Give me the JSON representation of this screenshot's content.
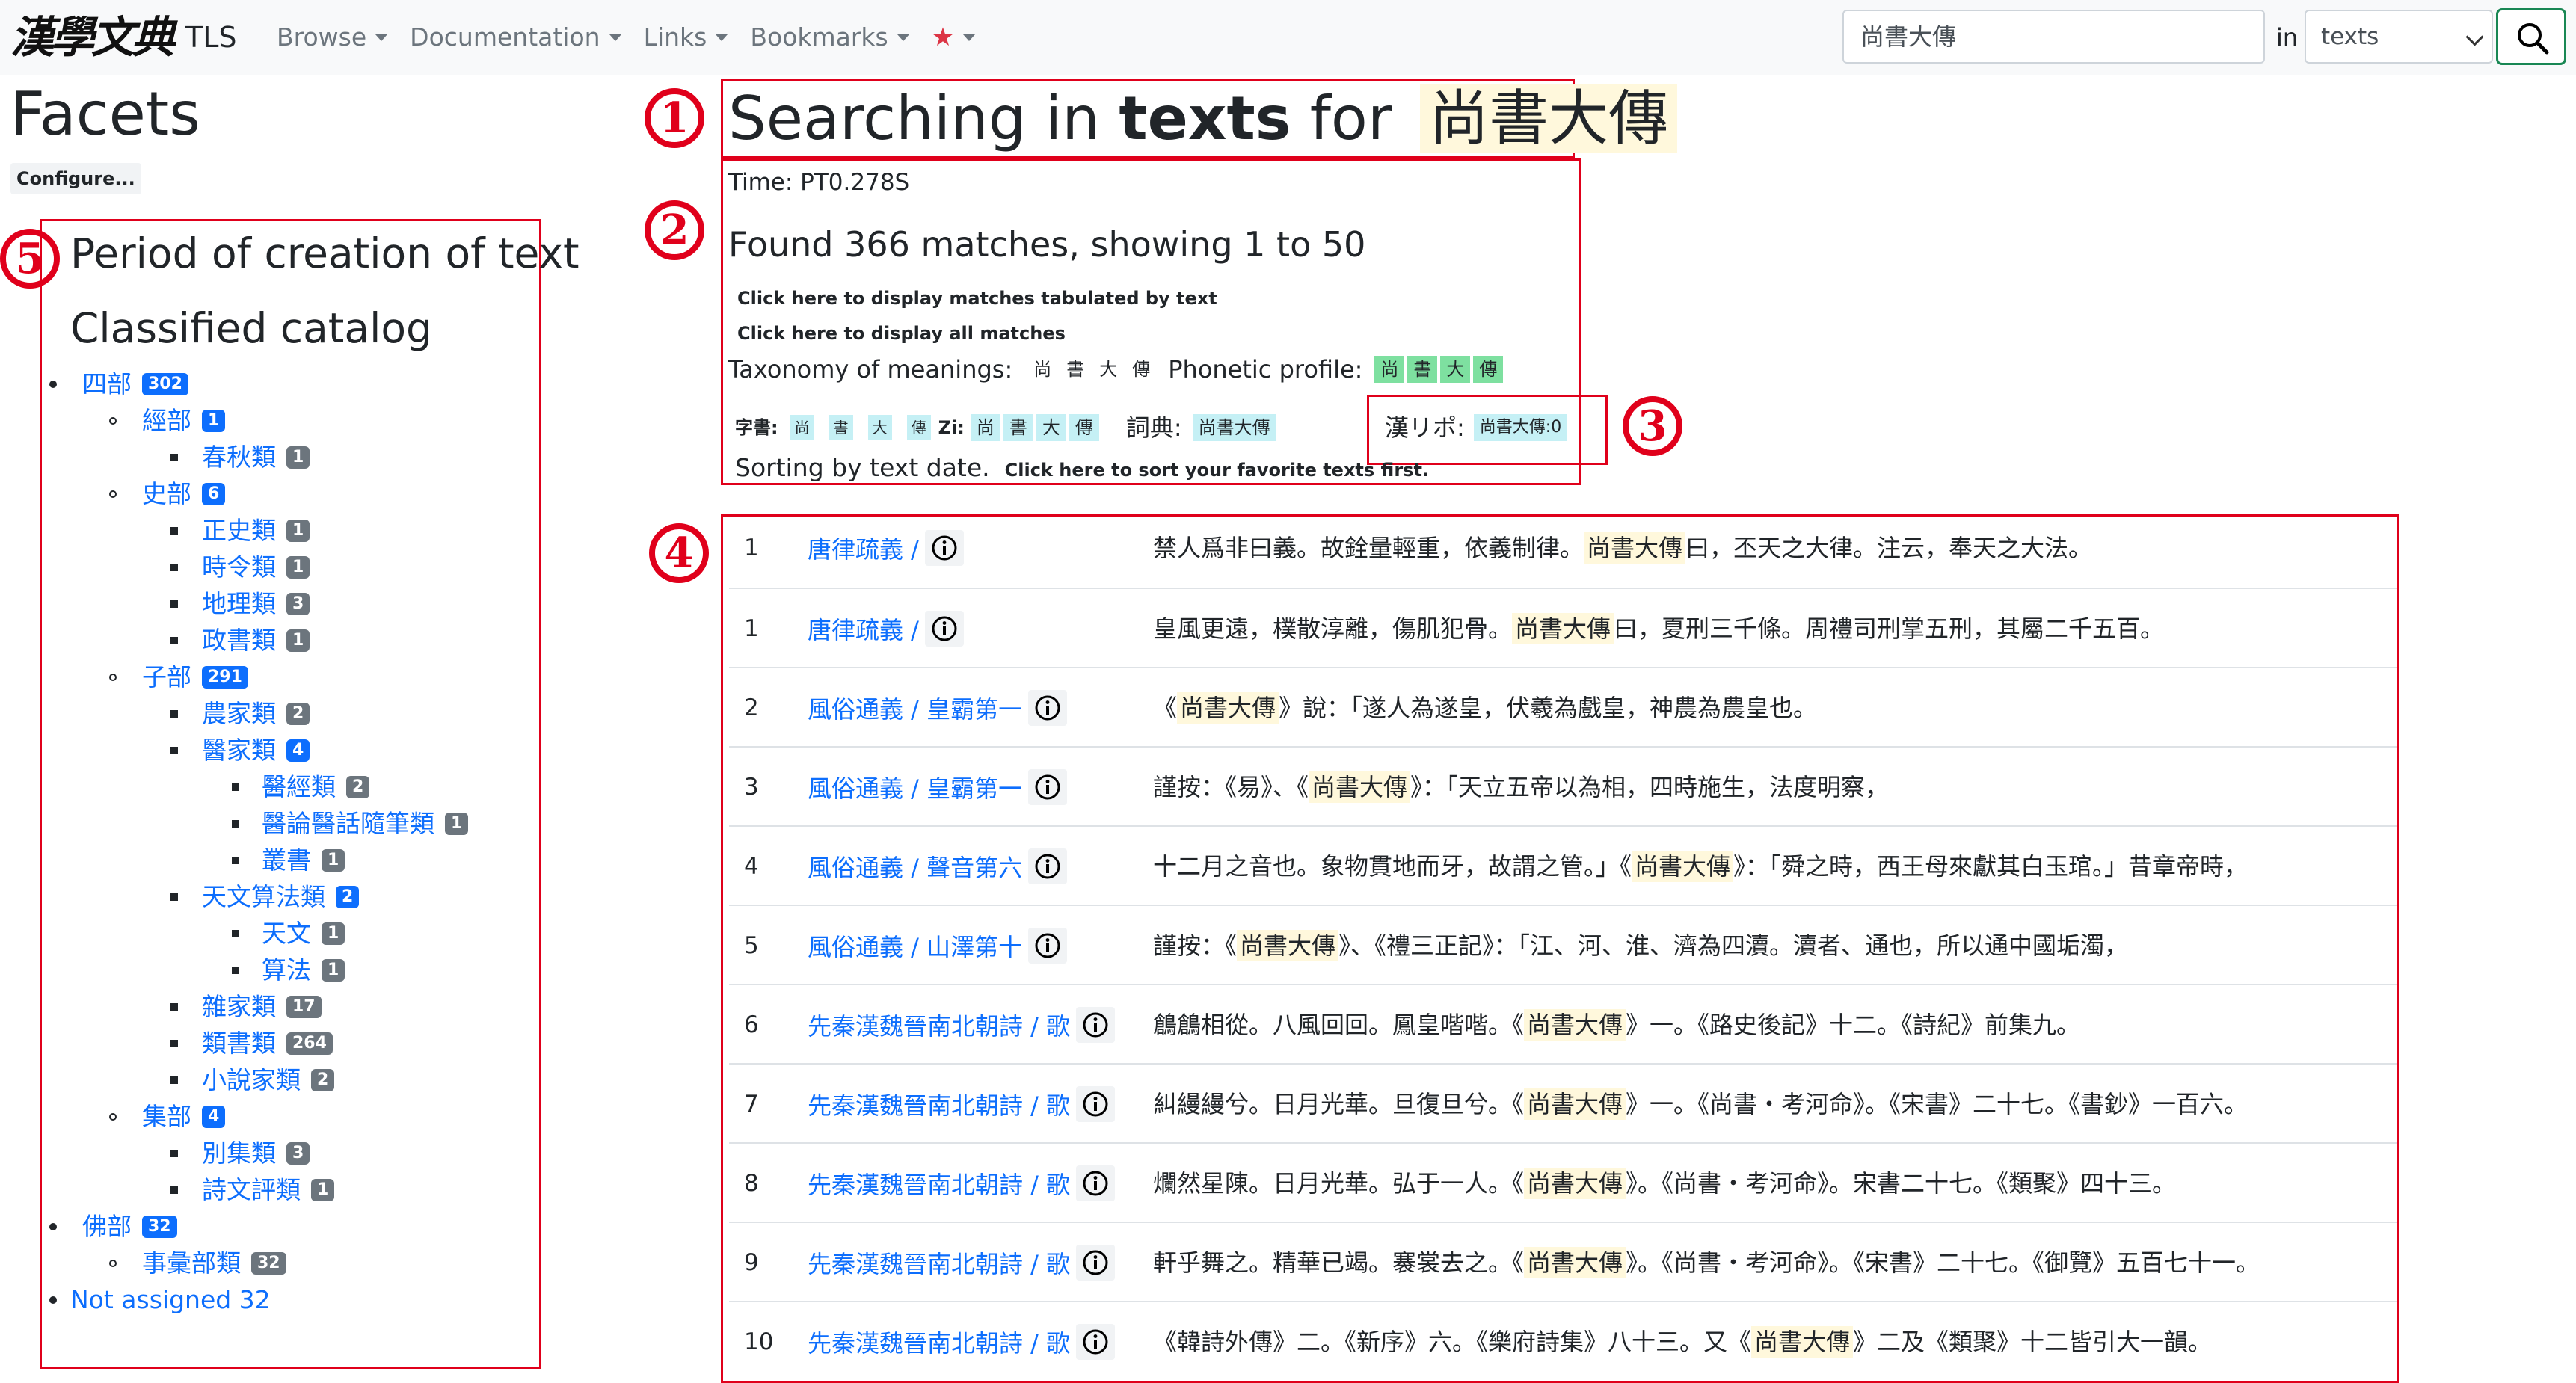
{
  "navbar": {
    "logo_text": "漢學文典",
    "brand": "TLS",
    "menu": [
      {
        "label": "Browse"
      },
      {
        "label": "Documentation"
      },
      {
        "label": "Links"
      },
      {
        "label": "Bookmarks"
      }
    ],
    "star_glyph": "★",
    "search_value": "尚書大傳",
    "in_label": "in",
    "scope_selected": "texts"
  },
  "facets": {
    "title": "Facets",
    "configure_label": "Configure...",
    "period_heading": "Period of creation of text",
    "catalog_heading": "Classified catalog",
    "tree": [
      {
        "label": "四部",
        "count": "302"
      },
      {
        "label": "經部",
        "count": "1"
      },
      {
        "label": "春秋類",
        "count": "1"
      },
      {
        "label": "史部",
        "count": "6"
      },
      {
        "label": "正史類",
        "count": "1"
      },
      {
        "label": "時令類",
        "count": "1"
      },
      {
        "label": "地理類",
        "count": "3"
      },
      {
        "label": "政書類",
        "count": "1"
      },
      {
        "label": "子部",
        "count": "291"
      },
      {
        "label": "農家類",
        "count": "2"
      },
      {
        "label": "醫家類",
        "count": "4"
      },
      {
        "label": "醫經類",
        "count": "2"
      },
      {
        "label": "醫論醫話隨筆類",
        "count": "1"
      },
      {
        "label": "叢書",
        "count": "1"
      },
      {
        "label": "天文算法類",
        "count": "2"
      },
      {
        "label": "天文",
        "count": "1"
      },
      {
        "label": "算法",
        "count": "1"
      },
      {
        "label": "雜家類",
        "count": "17"
      },
      {
        "label": "類書類",
        "count": "264"
      },
      {
        "label": "小說家類",
        "count": "2"
      },
      {
        "label": "集部",
        "count": "4"
      },
      {
        "label": "別集類",
        "count": "3"
      },
      {
        "label": "詩文評類",
        "count": "1"
      },
      {
        "label": "佛部",
        "count": "32"
      },
      {
        "label": "事彙部類",
        "count": "32"
      },
      {
        "label": "Not assigned 32",
        "count": ""
      }
    ]
  },
  "search": {
    "heading_pre": "Searching in ",
    "heading_scope": "texts",
    "heading_for": " for ",
    "heading_term": "尚書大傳",
    "time": "Time: PT0.278S",
    "found": "Found 366 matches, showing 1 to 50",
    "link_tabulated": "Click here to display matches tabulated by text",
    "link_all": "Click here to display all matches",
    "taxonomy_label": "Taxonomy of meanings:",
    "taxonomy_chars": [
      "尚",
      "書",
      "大",
      "傳"
    ],
    "phonetic_label": "Phonetic profile:",
    "phonetic_chars": [
      "尚",
      "書",
      "大",
      "傳"
    ],
    "zishu_label": "字書:",
    "zishu_chars": [
      "尚",
      "書",
      "大",
      "傳"
    ],
    "zi_label": "Zi:",
    "zi_chars": [
      "尚",
      "書",
      "大",
      "傳"
    ],
    "cidian_label": "詞典:",
    "cidian_value": "尚書大傳",
    "kanripo_label": "漢リポ:",
    "kanripo_value": "尚書大傳:0",
    "sorting": "Sorting by text date.",
    "sort_link": "Click here to sort your favorite texts first."
  },
  "annotations": [
    "1",
    "2",
    "3",
    "4",
    "5"
  ],
  "results": [
    {
      "num": "1",
      "source": "唐律疏義 /",
      "pre": "禁人爲非曰義。故銓量輕重，依義制律。",
      "hl": "尚書大傳",
      "post": "曰，丕天之大律。注云，奉天之大法。"
    },
    {
      "num": "1",
      "source": "唐律疏義 /",
      "pre": "皇風更遠，樸散淳離，傷肌犯骨。",
      "hl": "尚書大傳",
      "post": "曰，夏刑三千條。周禮司刑掌五刑，其屬二千五百。"
    },
    {
      "num": "2",
      "source": "風俗通義 / 皇霸第一",
      "pre": "《",
      "hl": "尚書大傳",
      "post": "》說：「遂人為遂皇，伏羲為戲皇，神農為農皇也。"
    },
    {
      "num": "3",
      "source": "風俗通義 / 皇霸第一",
      "pre": "謹按：《易》、《",
      "hl": "尚書大傳",
      "post": "》：「天立五帝以為相，四時施生，法度明察，"
    },
    {
      "num": "4",
      "source": "風俗通義 / 聲音第六",
      "pre": "十二月之音也。象物貫地而牙，故謂之管。」《",
      "hl": "尚書大傳",
      "post": "》：「舜之時，西王母來獻其白玉琯。」昔章帝時，"
    },
    {
      "num": "5",
      "source": "風俗通義 / 山澤第十",
      "pre": "謹按：《",
      "hl": "尚書大傳",
      "post": "》、《禮三正記》：「江、河、淮、濟為四瀆。瀆者、通也，所以通中國垢濁，"
    },
    {
      "num": "6",
      "source": "先秦漢魏晉南北朝詩 / 歌",
      "pre": "鶬鶬相從。八風回回。鳳皇喈喈。《",
      "hl": "尚書大傳",
      "post": "》一。《路史後記》十二。《詩紀》前集九。"
    },
    {
      "num": "7",
      "source": "先秦漢魏晉南北朝詩 / 歌",
      "pre": "糾縵縵兮。日月光華。旦復旦兮。《",
      "hl": "尚書大傳",
      "post": "》一。《尚書・考河命》。《宋書》二十七。《書鈔》一百六。"
    },
    {
      "num": "8",
      "source": "先秦漢魏晉南北朝詩 / 歌",
      "pre": "爛然星陳。日月光華。弘于一人。《",
      "hl": "尚書大傳",
      "post": "》。《尚書・考河命》。宋書二十七。《類聚》四十三。"
    },
    {
      "num": "9",
      "source": "先秦漢魏晉南北朝詩 / 歌",
      "pre": "軒乎舞之。精華已竭。褰裳去之。《",
      "hl": "尚書大傳",
      "post": "》。《尚書・考河命》。《宋書》二十七。《御覽》五百七十一。"
    },
    {
      "num": "10",
      "source": "先秦漢魏晉南北朝詩 / 歌",
      "pre": "《韓詩外傳》二。《新序》六。《樂府詩集》八十三。又《",
      "hl": "尚書大傳",
      "post": "》二及《類聚》十二皆引大一韻。"
    }
  ]
}
